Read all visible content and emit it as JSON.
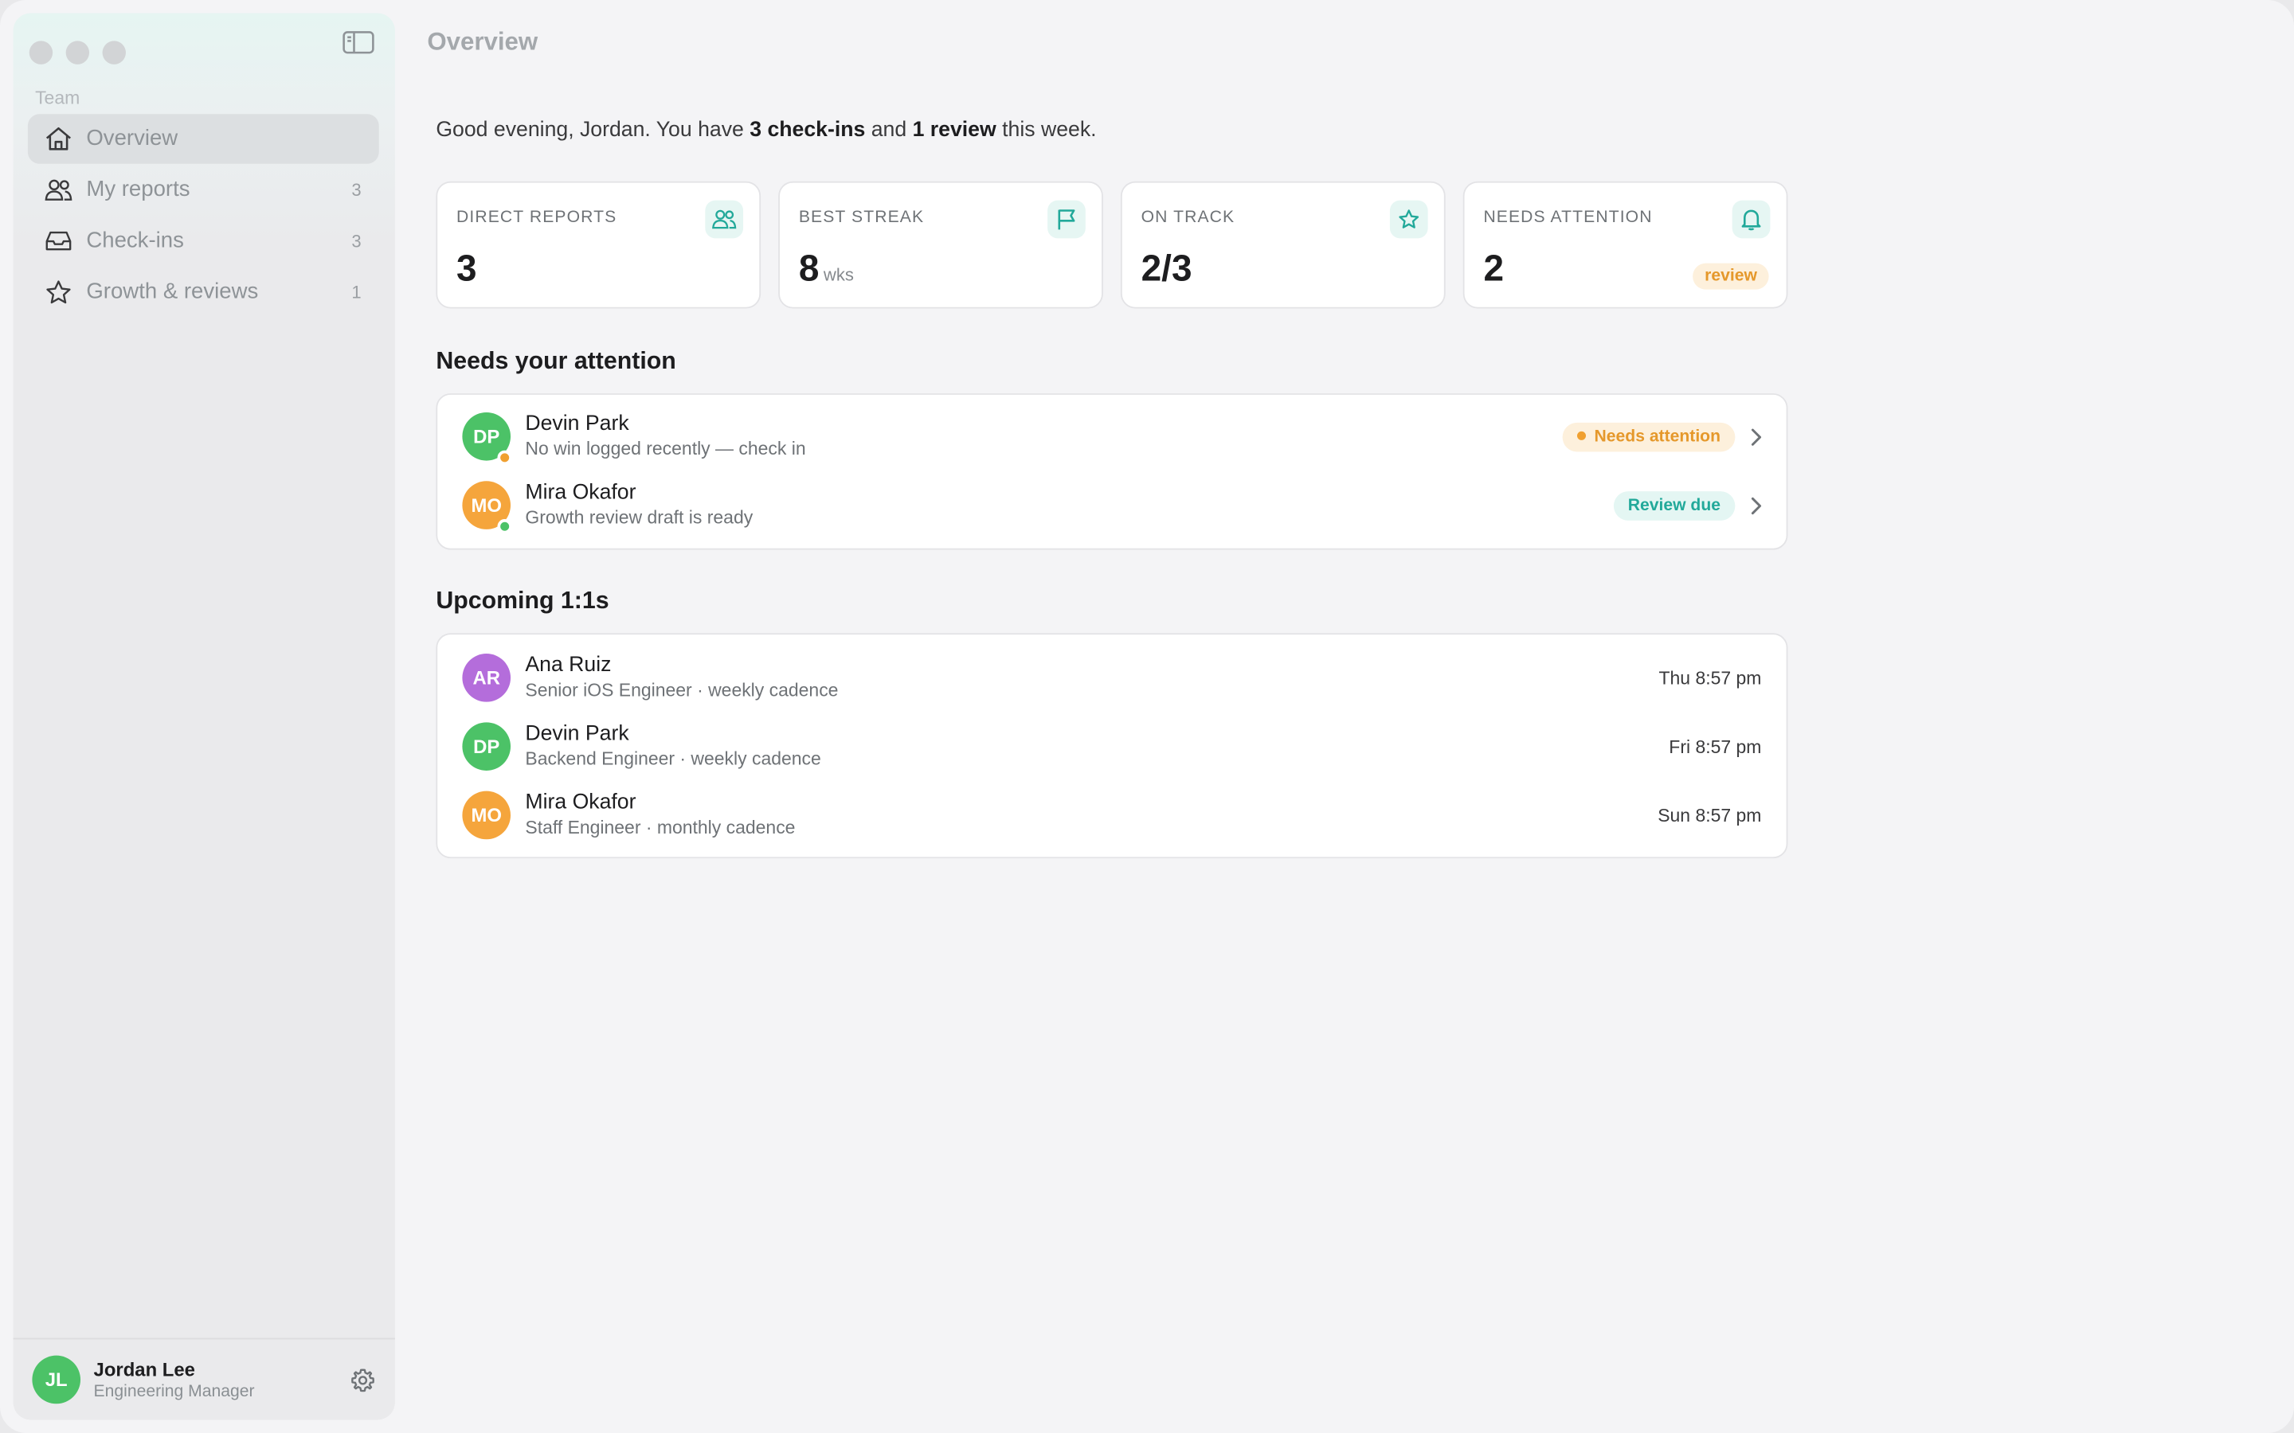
{
  "colors": {
    "accent": "#22a99a",
    "warning": "#e5982b",
    "online": "#4cc267",
    "away": "#f0a030"
  },
  "sidebar": {
    "toggle_icon": "sidebar-toggle-icon",
    "section_label": "Team",
    "items": [
      {
        "label": "Overview",
        "icon": "house-icon",
        "count": "",
        "active": true
      },
      {
        "label": "My reports",
        "icon": "people-icon",
        "count": "3"
      },
      {
        "label": "Check-ins",
        "icon": "inbox-icon",
        "count": "3"
      },
      {
        "label": "Growth & reviews",
        "icon": "star-icon",
        "count": "1"
      }
    ],
    "user": {
      "initials": "JL",
      "name": "Jordan Lee",
      "role": "Engineering Manager",
      "settings_icon": "gear-icon"
    }
  },
  "main": {
    "title": "Overview",
    "greeting": {
      "prefix": "Good evening, Jordan. You have ",
      "checkins": "3 check-ins",
      "middle": " and ",
      "reviews": "1 review",
      "suffix": " this week."
    },
    "stats": [
      {
        "label": "DIRECT REPORTS",
        "value": "3",
        "icon": "people-icon"
      },
      {
        "label": "BEST STREAK",
        "value": "8",
        "unit": "wks",
        "icon": "flag-icon"
      },
      {
        "label": "ON TRACK",
        "value": "2/3",
        "icon": "star-icon"
      },
      {
        "label": "NEEDS ATTENTION",
        "value": "2",
        "icon": "bell-icon",
        "badge": "review"
      }
    ],
    "attention": {
      "title": "Needs your attention",
      "items": [
        {
          "initials": "DP",
          "name": "Devin Park",
          "subtitle": "No win logged recently — check in",
          "badge": "Needs attention",
          "avatar_color": "#4cc267",
          "status_color": "#f0a030"
        },
        {
          "initials": "MO",
          "name": "Mira Okafor",
          "subtitle": "Growth review draft is ready",
          "badge": "Review due",
          "avatar_color": "#f5a53c",
          "status_color": "#4cc267"
        }
      ]
    },
    "upcoming": {
      "title": "Upcoming 1:1s",
      "items": [
        {
          "initials": "AR",
          "name": "Ana Ruiz",
          "subtitle": "Senior iOS Engineer · weekly cadence",
          "time": "Thu 8:57 pm",
          "avatar_color": "#b46ddb"
        },
        {
          "initials": "DP",
          "name": "Devin Park",
          "subtitle": "Backend Engineer · weekly cadence",
          "time": "Fri 8:57 pm",
          "avatar_color": "#4cc267"
        },
        {
          "initials": "MO",
          "name": "Mira Okafor",
          "subtitle": "Staff Engineer · monthly cadence",
          "time": "Sun 8:57 pm",
          "avatar_color": "#f5a53c"
        }
      ]
    }
  }
}
